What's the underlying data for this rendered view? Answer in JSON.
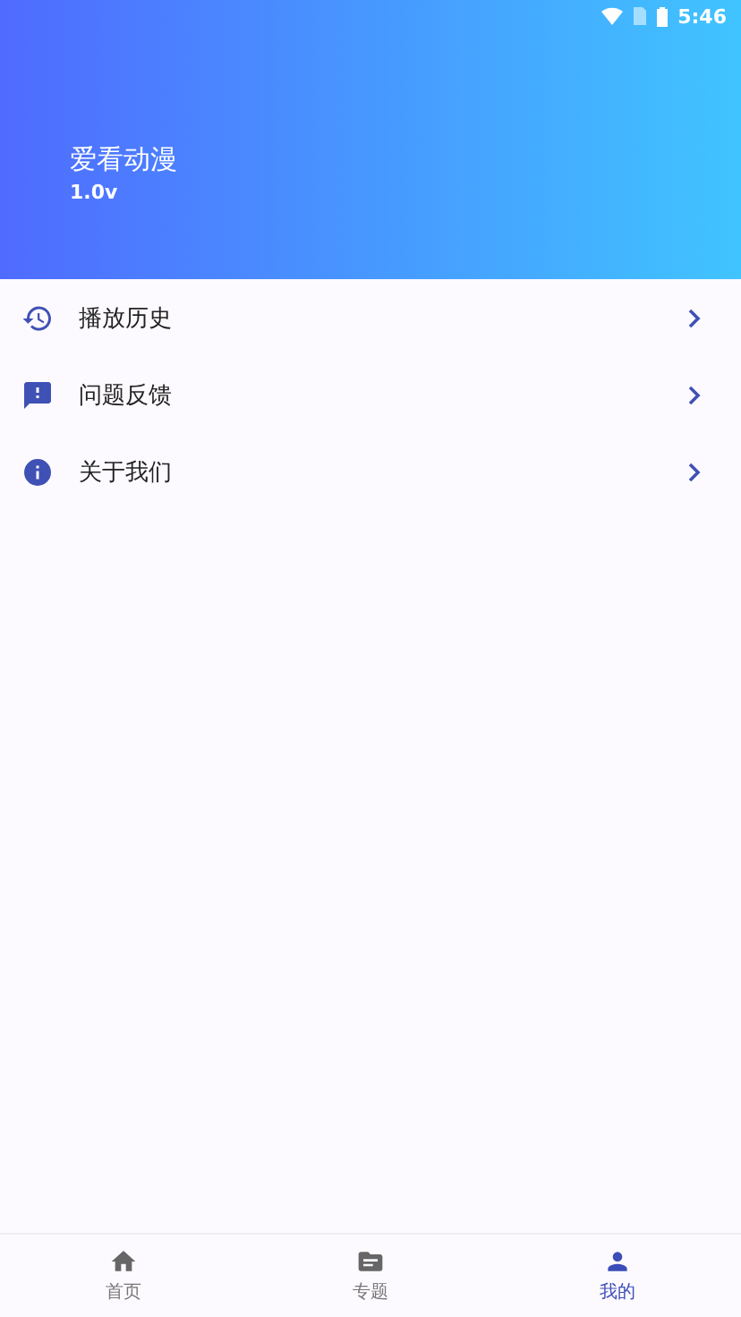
{
  "status_bar": {
    "time": "5:46"
  },
  "header": {
    "title": "爱看动漫",
    "version": "1.0v"
  },
  "menu": [
    {
      "kind": "history",
      "label": "播放历史"
    },
    {
      "kind": "feedback",
      "label": "问题反馈"
    },
    {
      "kind": "info",
      "label": "关于我们"
    }
  ],
  "tabs": [
    {
      "kind": "home",
      "label": "首页",
      "selected": false
    },
    {
      "kind": "folder",
      "label": "专题",
      "selected": false
    },
    {
      "kind": "person",
      "label": "我的",
      "selected": true
    }
  ]
}
